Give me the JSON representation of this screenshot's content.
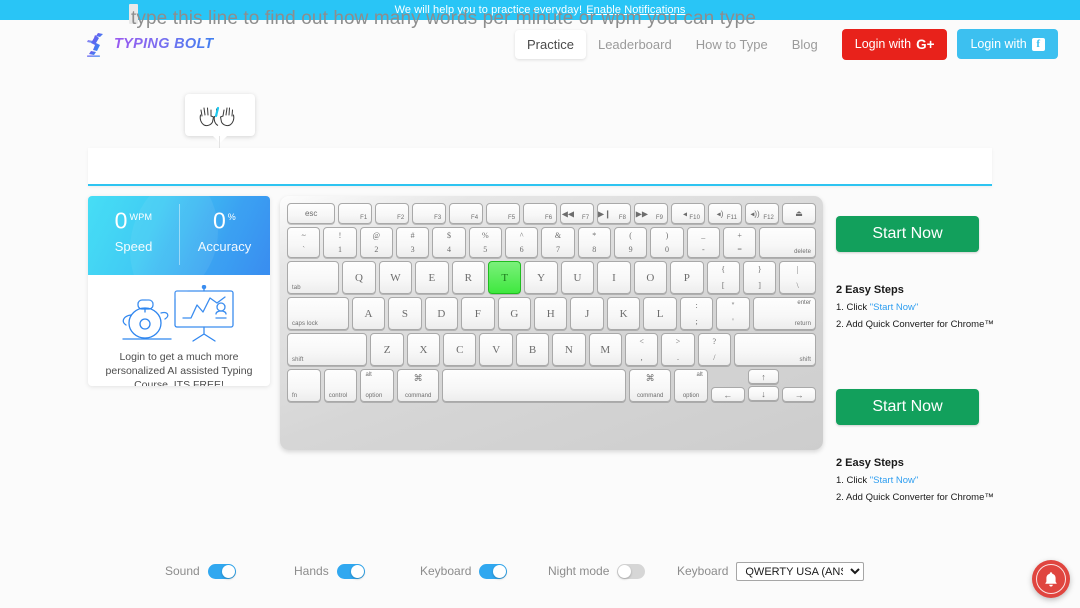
{
  "banner": {
    "message": "We will help you to practice everyday!",
    "link_label": "Enable Notifications"
  },
  "header": {
    "logo_text": "TYPING BOLT",
    "logo_icon": "bolt-runner-icon",
    "nav": [
      {
        "label": "Practice",
        "active": true
      },
      {
        "label": "Leaderboard",
        "active": false
      },
      {
        "label": "How to Type",
        "active": false
      },
      {
        "label": "Blog",
        "active": false
      }
    ],
    "login_google_label": "Login with",
    "login_google_mark": "G+",
    "login_facebook_label": "Login with",
    "login_facebook_mark": "f",
    "colors": {
      "google_red": "#e8221b",
      "facebook_blue": "#3cc0f0",
      "banner_cyan": "#29c5f6"
    }
  },
  "practice": {
    "hands_tooltip_icon": "two-hands-icon",
    "text_line": "type this line to find out how many words per minute or wpm you can type",
    "cursor_position": 0,
    "underline_color": "#2ec4f1"
  },
  "stats": {
    "speed_value": "0",
    "speed_unit": "WPM",
    "speed_label": "Speed",
    "accuracy_value": "0",
    "accuracy_unit": "%",
    "accuracy_label": "Accuracy",
    "promo_icon": "robot-presentation-icon",
    "promo_text": "Login to get a much more personalized AI assisted Typing Course. ITS FREE!"
  },
  "keyboard": {
    "active_key": "T",
    "active_key_color": "#3fe83f",
    "rows": {
      "function": [
        {
          "main": "esc",
          "pos": "center-small",
          "flex": 1.45
        },
        {
          "main": "F1",
          "pos": "br",
          "flex": 1
        },
        {
          "main": "F2",
          "pos": "br",
          "flex": 1
        },
        {
          "main": "F3",
          "pos": "br",
          "flex": 1
        },
        {
          "main": "F4",
          "pos": "br",
          "flex": 1
        },
        {
          "main": "F5",
          "pos": "br",
          "flex": 1
        },
        {
          "main": "F6",
          "pos": "br",
          "flex": 1
        },
        {
          "main": "F7",
          "icon": "◀◀",
          "pos": "media",
          "flex": 1
        },
        {
          "main": "F8",
          "icon": "▶❙",
          "pos": "media",
          "flex": 1
        },
        {
          "main": "F9",
          "icon": "▶▶",
          "pos": "media",
          "flex": 1
        },
        {
          "main": "F10",
          "icon": "◂",
          "pos": "media",
          "flex": 1
        },
        {
          "main": "F11",
          "icon": "◂)",
          "pos": "media",
          "flex": 1
        },
        {
          "main": "F12",
          "icon": "◂))",
          "pos": "media",
          "flex": 1
        },
        {
          "main": "⏏",
          "pos": "center",
          "flex": 1
        }
      ],
      "numbers": [
        {
          "up": "~",
          "lo": "`",
          "flex": 1
        },
        {
          "up": "!",
          "lo": "1",
          "flex": 1
        },
        {
          "up": "@",
          "lo": "2",
          "flex": 1
        },
        {
          "up": "#",
          "lo": "3",
          "flex": 1
        },
        {
          "up": "$",
          "lo": "4",
          "flex": 1
        },
        {
          "up": "%",
          "lo": "5",
          "flex": 1
        },
        {
          "up": "^",
          "lo": "6",
          "flex": 1
        },
        {
          "up": "&",
          "lo": "7",
          "flex": 1
        },
        {
          "up": "*",
          "lo": "8",
          "flex": 1
        },
        {
          "up": "(",
          "lo": "9",
          "flex": 1
        },
        {
          "up": ")",
          "lo": "0",
          "flex": 1
        },
        {
          "up": "_",
          "lo": "-",
          "flex": 1
        },
        {
          "up": "+",
          "lo": "=",
          "flex": 1
        },
        {
          "label_br": "delete",
          "flex": 1.75
        }
      ],
      "top": [
        {
          "label_bl": "tab",
          "flex": 1.6
        },
        {
          "main": "Q",
          "flex": 1
        },
        {
          "main": "W",
          "flex": 1
        },
        {
          "main": "E",
          "flex": 1
        },
        {
          "main": "R",
          "flex": 1
        },
        {
          "main": "T",
          "flex": 1,
          "active": true
        },
        {
          "main": "Y",
          "flex": 1
        },
        {
          "main": "U",
          "flex": 1
        },
        {
          "main": "I",
          "flex": 1
        },
        {
          "main": "O",
          "flex": 1
        },
        {
          "main": "P",
          "flex": 1
        },
        {
          "up": "{",
          "lo": "[",
          "flex": 1
        },
        {
          "up": "}",
          "lo": "]",
          "flex": 1
        },
        {
          "up": "|",
          "lo": "\\",
          "flex": 1.1
        }
      ],
      "home": [
        {
          "label_bl": "caps lock",
          "flex": 1.9
        },
        {
          "main": "A",
          "flex": 1
        },
        {
          "main": "S",
          "flex": 1
        },
        {
          "main": "D",
          "flex": 1
        },
        {
          "main": "F",
          "flex": 1
        },
        {
          "main": "G",
          "flex": 1
        },
        {
          "main": "H",
          "flex": 1
        },
        {
          "main": "J",
          "flex": 1
        },
        {
          "main": "K",
          "flex": 1
        },
        {
          "main": "L",
          "flex": 1
        },
        {
          "up": ":",
          "lo": ";",
          "flex": 1
        },
        {
          "up": "\"",
          "lo": "'",
          "flex": 1
        },
        {
          "label_tr": "enter",
          "label_br": "return",
          "flex": 1.95
        }
      ],
      "bottom": [
        {
          "label_bl": "shift",
          "flex": 2.5
        },
        {
          "main": "Z",
          "flex": 1
        },
        {
          "main": "X",
          "flex": 1
        },
        {
          "main": "C",
          "flex": 1
        },
        {
          "main": "V",
          "flex": 1
        },
        {
          "main": "B",
          "flex": 1
        },
        {
          "main": "N",
          "flex": 1
        },
        {
          "main": "M",
          "flex": 1
        },
        {
          "up": "<",
          "lo": ",",
          "flex": 1
        },
        {
          "up": ">",
          "lo": ".",
          "flex": 1
        },
        {
          "up": "?",
          "lo": "/",
          "flex": 1
        },
        {
          "label_br": "shift",
          "flex": 2.55
        }
      ],
      "modifier": [
        {
          "label_bl": "fn",
          "flex": 1.15
        },
        {
          "label_bl": "control",
          "flex": 1.15
        },
        {
          "label_tl": "alt",
          "label_bl": "option",
          "flex": 1.15
        },
        {
          "cmd": "⌘",
          "label_c": "command",
          "flex": 1.45
        },
        {
          "space": true,
          "flex": 6.6
        },
        {
          "cmd": "⌘",
          "label_c": "command",
          "flex": 1.45
        },
        {
          "label_tr_alt": "alt",
          "label_c": "option",
          "flex": 1.15
        }
      ],
      "arrows": {
        "left": "←",
        "up": "↑",
        "down": "↓",
        "right": "→"
      }
    }
  },
  "cta": {
    "start_label": "Start Now",
    "steps_title": "2 Easy Steps",
    "step1_prefix": "1. Click",
    "step1_link": "\"Start Now\"",
    "step2": "2. Add Quick Converter for Chrome™",
    "button_color": "#12a05c"
  },
  "controls": {
    "sound_label": "Sound",
    "sound_on": true,
    "hands_label": "Hands",
    "hands_on": true,
    "keyboard_label": "Keyboard",
    "keyboard_on": true,
    "night_label": "Night mode",
    "night_on": false,
    "layout_label": "Keyboard",
    "layout_value": "QWERTY USA (ANSI)",
    "layout_options": [
      "QWERTY USA (ANSI)"
    ]
  },
  "notification_widget": {
    "icon": "bell-icon",
    "color": "#e0453f"
  }
}
